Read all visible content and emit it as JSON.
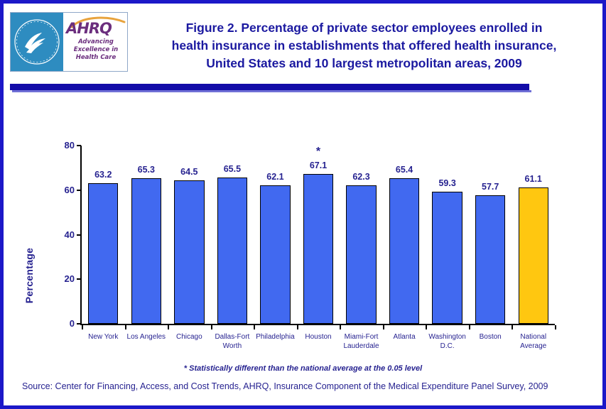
{
  "header": {
    "logo": {
      "hhs_seal_name": "hhs-department-seal",
      "hhs_seal_text": "DEPARTMENT OF HEALTH & HUMAN SERVICES USA",
      "ahrq_wordmark": "AHRQ",
      "ahrq_tagline_line1": "Advancing",
      "ahrq_tagline_line2": "Excellence in",
      "ahrq_tagline_line3": "Health Care"
    },
    "title_line1": "Figure 2. Percentage of private sector employees enrolled in",
    "title_line2": "health insurance in establishments that offered health insurance,",
    "title_line3": "United States and 10 largest metropolitan areas, 2009"
  },
  "chart_data": {
    "type": "bar",
    "title": "Figure 2. Percentage of private sector employees enrolled in health insurance in establishments that offered health insurance, United States and 10 largest metropolitan areas, 2009",
    "xlabel": "",
    "ylabel": "Percentage",
    "ylim": [
      0,
      80
    ],
    "yticks": [
      0,
      20,
      40,
      60,
      80
    ],
    "grid": false,
    "legend": "none",
    "categories": [
      "New York",
      "Los Angeles",
      "Chicago",
      "Dallas-Fort Worth",
      "Philadelphia",
      "Houston",
      "Miami-Fort Lauderdale",
      "Atlanta",
      "Washington D.C.",
      "Boston",
      "National Average"
    ],
    "category_lines": [
      [
        "New York"
      ],
      [
        "Los Angeles"
      ],
      [
        "Chicago"
      ],
      [
        "Dallas-Fort",
        "Worth"
      ],
      [
        "Philadelphia"
      ],
      [
        "Houston"
      ],
      [
        "Miami-Fort",
        "Lauderdale"
      ],
      [
        "Atlanta"
      ],
      [
        "Washington",
        "D.C."
      ],
      [
        "Boston"
      ],
      [
        "National",
        "Average"
      ]
    ],
    "values": [
      63.2,
      65.3,
      64.5,
      65.5,
      62.1,
      67.1,
      62.3,
      65.4,
      59.3,
      57.7,
      61.1
    ],
    "value_labels": [
      "63.2",
      "65.3",
      "64.5",
      "65.5",
      "62.1",
      "67.1",
      "62.3",
      "65.4",
      "59.3",
      "57.7",
      "61.1"
    ],
    "significance_markers": [
      "",
      "",
      "",
      "",
      "",
      "*",
      "",
      "",
      "",
      "",
      ""
    ],
    "bar_colors": [
      "#4169F0",
      "#4169F0",
      "#4169F0",
      "#4169F0",
      "#4169F0",
      "#4169F0",
      "#4169F0",
      "#4169F0",
      "#4169F0",
      "#4169F0",
      "#FFC710"
    ],
    "bar_border_color": "#000000"
  },
  "footer": {
    "footnote": "* Statistically different than the national average at the 0.05 level",
    "source": "Source: Center for Financing, Access, and Cost Trends, AHRQ, Insurance Component of the Medical Expenditure Panel Survey, 2009"
  },
  "colors": {
    "page_border": "#1C18C8",
    "title_text": "#1B19A0",
    "rule": "#120CA8",
    "axis_text": "#262290",
    "bar_blue": "#4169F0",
    "bar_gold": "#FFC710"
  }
}
